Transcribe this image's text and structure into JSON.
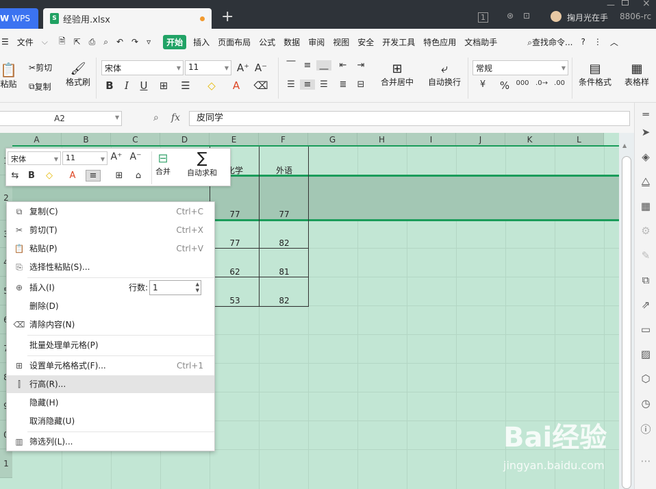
{
  "tabs": {
    "app": "WPS",
    "file": "经验用.xlsx"
  },
  "titlebar": {
    "badge": "1",
    "user": "掬月光在手",
    "code": "8806-rc"
  },
  "menu": {
    "file": "文件",
    "items": [
      "开始",
      "插入",
      "页面布局",
      "公式",
      "数据",
      "审阅",
      "视图",
      "安全",
      "开发工具",
      "特色应用",
      "文档助手"
    ],
    "search": "查找命令...",
    "help": "?"
  },
  "ribbon": {
    "paste": "粘贴",
    "cut": "剪切",
    "copy": "复制",
    "format_painter": "格式刷",
    "font": "宋体",
    "size": "11",
    "merge": "合并居中",
    "wrap": "自动换行",
    "numfmt": "常规",
    "cond": "条件格式",
    "table": "表格样"
  },
  "formula": {
    "cell": "A2",
    "fx": "fx",
    "value": "皮同学"
  },
  "columns": [
    "A",
    "B",
    "C",
    "D",
    "E",
    "F",
    "G",
    "H",
    "I",
    "J",
    "K",
    "L"
  ],
  "rows": [
    "1",
    "2",
    "3",
    "4",
    "5",
    "6",
    "7",
    "8",
    "9",
    "0",
    "1"
  ],
  "cells": {
    "e1": "化学",
    "f1": "外语",
    "e2": "77",
    "f2": "77",
    "e3": "77",
    "f3": "82",
    "e4": "62",
    "f4": "81",
    "e5": "53",
    "f5": "82"
  },
  "mini_toolbar": {
    "font": "宋体",
    "size": "11",
    "merge": "合并",
    "autosum": "自动求和"
  },
  "context_menu": {
    "copy": {
      "label": "复制(C)",
      "shortcut": "Ctrl+C"
    },
    "cut": {
      "label": "剪切(T)",
      "shortcut": "Ctrl+X"
    },
    "paste": {
      "label": "粘贴(P)",
      "shortcut": "Ctrl+V"
    },
    "paste_special": "选择性粘贴(S)...",
    "insert": "插入(I)",
    "rows_label": "行数:",
    "rows_value": "1",
    "delete": "删除(D)",
    "clear": "清除内容(N)",
    "batch": "批量处理单元格(P)",
    "format": {
      "label": "设置单元格格式(F)...",
      "shortcut": "Ctrl+1"
    },
    "row_height": "行高(R)...",
    "hide": "隐藏(H)",
    "unhide": "取消隐藏(U)",
    "filter": "筛选列(L)..."
  },
  "watermark": {
    "main": "Bai经验",
    "sub": "jingyan.baidu.com"
  }
}
